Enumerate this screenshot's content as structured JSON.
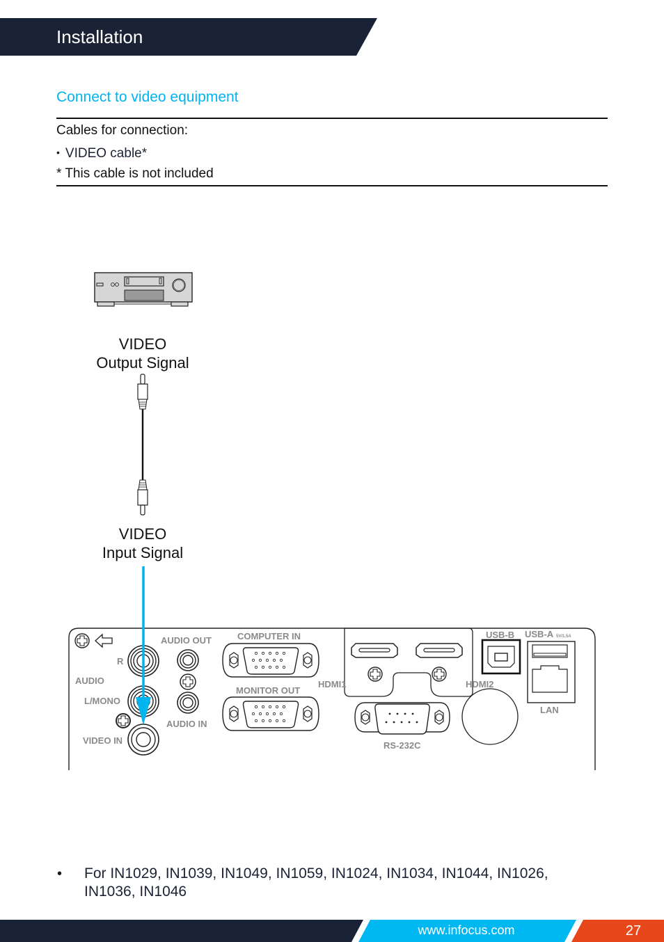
{
  "header": {
    "title": "Installation",
    "band_color": "#1a2335"
  },
  "section": {
    "title": "Connect to video equipment",
    "title_color": "#00b4f0",
    "cables_heading": "Cables for connection:",
    "cables": [
      {
        "bullet": "•",
        "label": "VIDEO cable*"
      }
    ],
    "footnote": "* This cable is not included"
  },
  "diagram": {
    "source_device": "video-player",
    "output_label_line1": "VIDEO",
    "output_label_line2": "Output Signal",
    "input_label_line1": "VIDEO",
    "input_label_line2": "Input Signal",
    "arrow_color": "#00b4f0",
    "panel": {
      "labels": {
        "audio_out": "AUDIO OUT",
        "computer_in": "COMPUTER IN",
        "r": "R",
        "audio": "AUDIO",
        "l_mono": "L/MONO",
        "video_in": "VIDEO IN",
        "audio_in": "AUDIO IN",
        "monitor_out": "MONITOR OUT",
        "hdmi1": "HDMI1",
        "hdmi2": "HDMI2",
        "rs232c": "RS-232C",
        "usb_b": "USB-B",
        "usb_a": "USB-A",
        "usb_a_rating": "5V/1.5A",
        "lan": "LAN"
      }
    }
  },
  "note": {
    "bullet": "•",
    "text": "For IN1029, IN1039, IN1049, IN1059, IN1024, IN1034, IN1044, IN1026, IN1036, IN1046"
  },
  "footer": {
    "url": "www.infocus.com",
    "page_number": "27",
    "colors": {
      "dark": "#1a2335",
      "blue": "#00b8f1",
      "orange": "#e8461b"
    }
  }
}
